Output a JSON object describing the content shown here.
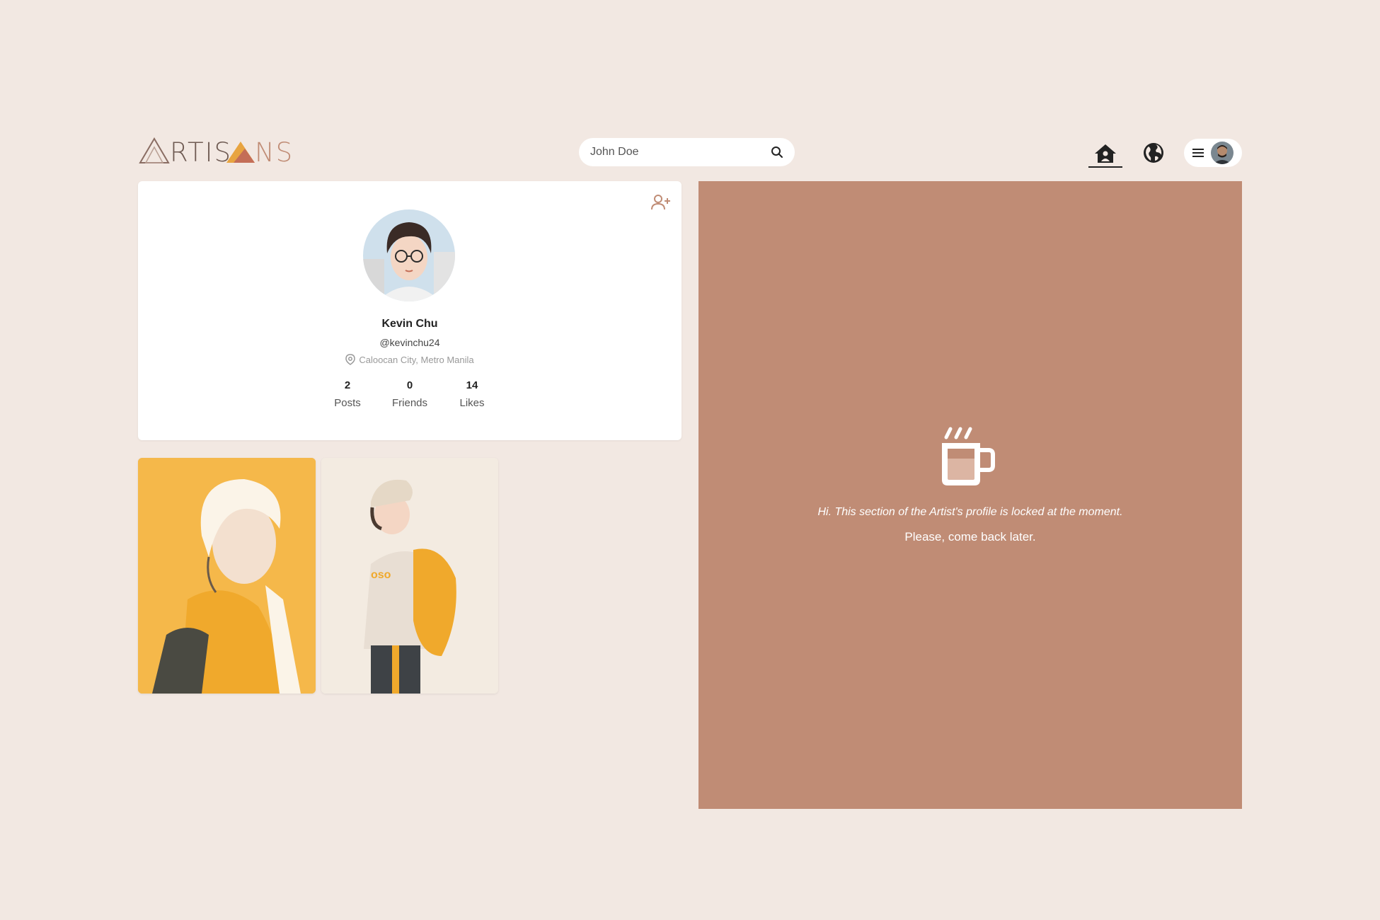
{
  "header": {
    "logo_text": "ARTISANS",
    "search": {
      "placeholder": "John Doe",
      "icon": "search-icon"
    },
    "nav": [
      {
        "name": "home",
        "icon": "home-icon",
        "active": true
      },
      {
        "name": "explore",
        "icon": "globe-icon",
        "active": false
      }
    ],
    "user_menu": {
      "icon": "hamburger-icon"
    }
  },
  "profile": {
    "name": "Kevin Chu",
    "handle": "@kevinchu24",
    "location": "Caloocan City, Metro Manila",
    "stats": [
      {
        "value": "2",
        "label": "Posts"
      },
      {
        "value": "0",
        "label": "Friends"
      },
      {
        "value": "14",
        "label": "Likes"
      }
    ],
    "add_friend_icon": "add-user-icon"
  },
  "posts": [
    {
      "title": "Boy in yellow jacket",
      "bg": "#f5b84a"
    },
    {
      "title": "Boy with cap and backpack",
      "bg": "#f3ebe1"
    }
  ],
  "locked_panel": {
    "icon": "coffee-mug-icon",
    "message": "Hi. This section of the Artist's profile is locked at the moment.",
    "sub_message": "Please, come back later.",
    "bg": "#c08c75"
  },
  "colors": {
    "page_bg": "#f2e8e2",
    "accent": "#c08c75",
    "brand": "#8a6d63"
  }
}
